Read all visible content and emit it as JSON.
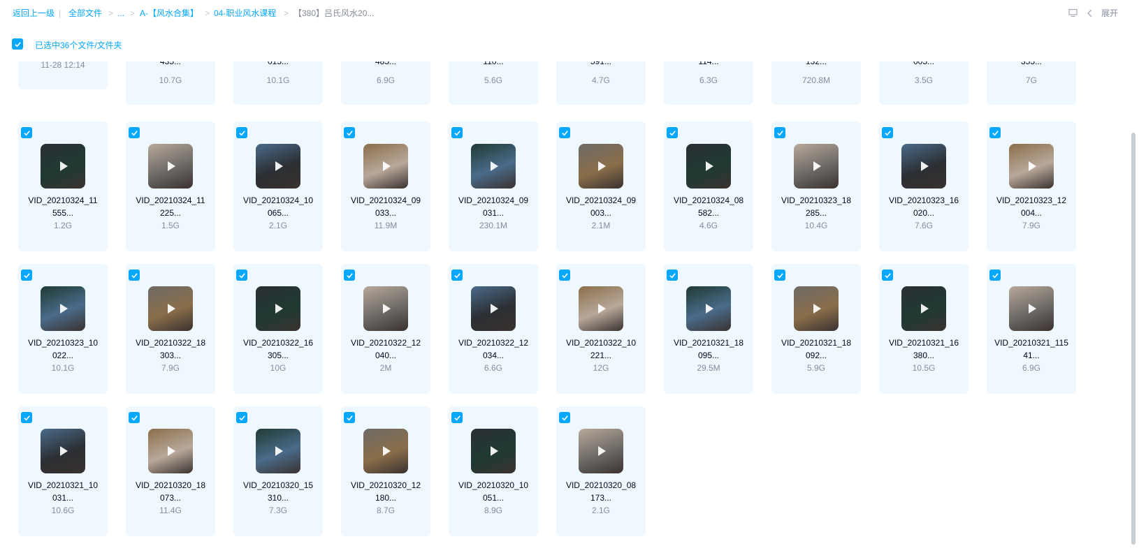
{
  "breadcrumb": {
    "back": "返回上一级",
    "all_files": "全部文件",
    "ellipsis": "...",
    "folder1": "A-【风水合集】",
    "folder2": "04-职业风水课程",
    "current": "【380】吕氏风水20..."
  },
  "toolbar": {
    "expand_label": "展开"
  },
  "selection": {
    "text": "已选中36个文件/文件夹"
  },
  "partial_row": [
    {
      "name": "",
      "size": "",
      "date": "11-28 12:14"
    },
    {
      "name": "435...",
      "size": "10.7G"
    },
    {
      "name": "015...",
      "size": "10.1G"
    },
    {
      "name": "485...",
      "size": "6.9G"
    },
    {
      "name": "110...",
      "size": "5.6G"
    },
    {
      "name": "591...",
      "size": "4.7G"
    },
    {
      "name": "114...",
      "size": "6.3G"
    },
    {
      "name": "132...",
      "size": "720.8M"
    },
    {
      "name": "005...",
      "size": "3.5G"
    },
    {
      "name": "355...",
      "size": "7G"
    }
  ],
  "files": [
    {
      "l1": "VID_20210324_11",
      "l2": "555...",
      "size": "1.2G"
    },
    {
      "l1": "VID_20210324_11",
      "l2": "225...",
      "size": "1.5G"
    },
    {
      "l1": "VID_20210324_10",
      "l2": "065...",
      "size": "2.1G"
    },
    {
      "l1": "VID_20210324_09",
      "l2": "033...",
      "size": "11.9M"
    },
    {
      "l1": "VID_20210324_09",
      "l2": "031...",
      "size": "230.1M"
    },
    {
      "l1": "VID_20210324_09",
      "l2": "003...",
      "size": "2.1M"
    },
    {
      "l1": "VID_20210324_08",
      "l2": "582...",
      "size": "4.6G"
    },
    {
      "l1": "VID_20210323_18",
      "l2": "285...",
      "size": "10.4G"
    },
    {
      "l1": "VID_20210323_16",
      "l2": "020...",
      "size": "7.6G"
    },
    {
      "l1": "VID_20210323_12",
      "l2": "004...",
      "size": "7.9G"
    },
    {
      "l1": "VID_20210323_10",
      "l2": "022...",
      "size": "10.1G"
    },
    {
      "l1": "VID_20210322_18",
      "l2": "303...",
      "size": "7.9G"
    },
    {
      "l1": "VID_20210322_16",
      "l2": "305...",
      "size": "10G"
    },
    {
      "l1": "VID_20210322_12",
      "l2": "040...",
      "size": "2M"
    },
    {
      "l1": "VID_20210322_12",
      "l2": "034...",
      "size": "6.6G"
    },
    {
      "l1": "VID_20210322_10",
      "l2": "221...",
      "size": "12G"
    },
    {
      "l1": "VID_20210321_18",
      "l2": "095...",
      "size": "29.5M"
    },
    {
      "l1": "VID_20210321_18",
      "l2": "092...",
      "size": "5.9G"
    },
    {
      "l1": "VID_20210321_16",
      "l2": "380...",
      "size": "10.5G"
    },
    {
      "l1": "VID_20210321_115",
      "l2": "41...",
      "size": "6.9G"
    },
    {
      "l1": "VID_20210321_10",
      "l2": "031...",
      "size": "10.6G"
    },
    {
      "l1": "VID_20210320_18",
      "l2": "073...",
      "size": "11.4G"
    },
    {
      "l1": "VID_20210320_15",
      "l2": "310...",
      "size": "7.3G"
    },
    {
      "l1": "VID_20210320_12",
      "l2": "180...",
      "size": "8.7G"
    },
    {
      "l1": "VID_20210320_10",
      "l2": "051...",
      "size": "8.9G"
    },
    {
      "l1": "VID_20210320_08",
      "l2": "173...",
      "size": "2.1G"
    }
  ],
  "colors": {
    "accent": "#06a7ff",
    "card_bg": "#eef8fe",
    "thumb_palettes": [
      "#1f3a33",
      "#6d6a66",
      "#2c2f33",
      "#b8a89a",
      "#4a6b8a",
      "#8a6e4a"
    ]
  }
}
